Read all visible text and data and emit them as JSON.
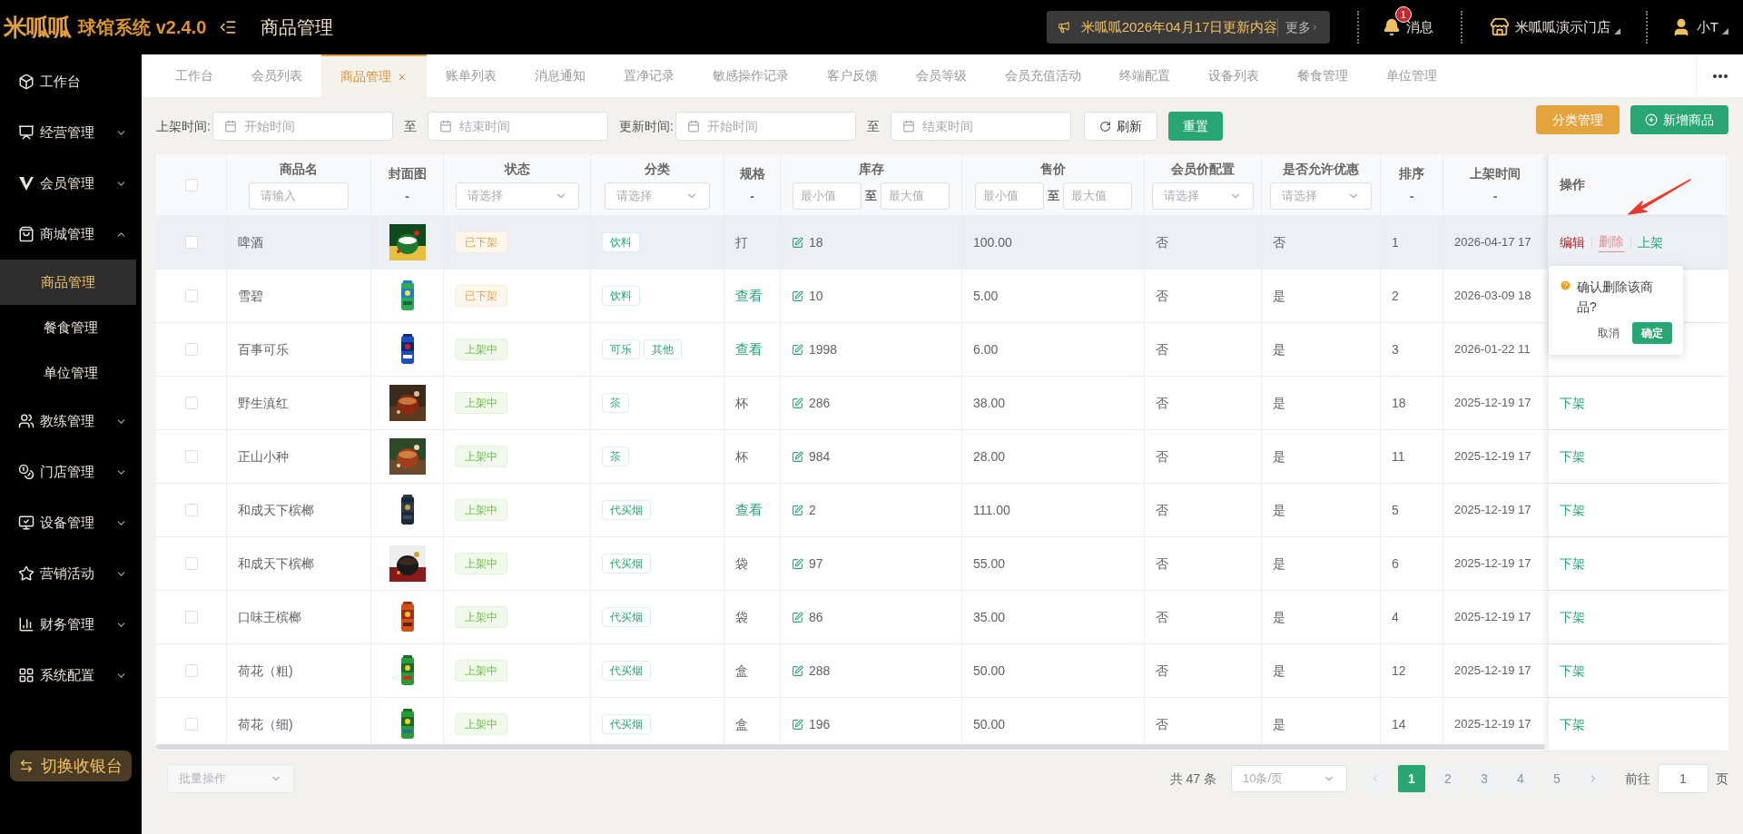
{
  "header": {
    "logo": "米呱呱",
    "app_title": "球馆系统 v2.4.0",
    "page_title": "商品管理",
    "notice": {
      "text": "米呱呱2026年04月17日更新内容",
      "more": "更多"
    },
    "messages": {
      "label": "消息",
      "badge": "1"
    },
    "store": "米呱呱演示门店",
    "user": "小T"
  },
  "sidebar": {
    "items": [
      {
        "label": "工作台"
      },
      {
        "label": "经营管理",
        "expanded": false
      },
      {
        "label": "会员管理",
        "expanded": false
      },
      {
        "label": "商城管理",
        "expanded": true,
        "children": [
          {
            "label": "商品管理",
            "selected": true
          },
          {
            "label": "餐食管理",
            "selected": false
          },
          {
            "label": "单位管理",
            "selected": false
          }
        ]
      },
      {
        "label": "教练管理",
        "expanded": false
      },
      {
        "label": "门店管理",
        "expanded": false
      },
      {
        "label": "设备管理",
        "expanded": false
      },
      {
        "label": "营销活动",
        "expanded": false
      },
      {
        "label": "财务管理",
        "expanded": false
      },
      {
        "label": "系统配置",
        "expanded": false
      }
    ],
    "cashier_button": "切换收银台"
  },
  "tabs": [
    {
      "label": "工作台",
      "selected": false
    },
    {
      "label": "会员列表",
      "selected": false
    },
    {
      "label": "商品管理",
      "selected": true
    },
    {
      "label": "账单列表",
      "selected": false
    },
    {
      "label": "消息通知",
      "selected": false
    },
    {
      "label": "置净记录",
      "selected": false
    },
    {
      "label": "敏感操作记录",
      "selected": false
    },
    {
      "label": "客户反馈",
      "selected": false
    },
    {
      "label": "会员等级",
      "selected": false
    },
    {
      "label": "会员充值活动",
      "selected": false
    },
    {
      "label": "终端配置",
      "selected": false
    },
    {
      "label": "设备列表",
      "selected": false
    },
    {
      "label": "餐食管理",
      "selected": false
    },
    {
      "label": "单位管理",
      "selected": false
    }
  ],
  "filters": {
    "listed_label": "上架时间:",
    "updated_label": "更新时间:",
    "start_placeholder": "开始时间",
    "end_placeholder": "结束时间",
    "start_placeholder_2": "开始时间",
    "end_placeholder_2": "结束时间",
    "to": "至",
    "to_2": "至",
    "refresh": "刷新",
    "reset": "重置",
    "category_manage": "分类管理",
    "add_product": "新增商品"
  },
  "table": {
    "select_all_checked": false,
    "columns": [
      {
        "label": "商品名",
        "kind": "input",
        "placeholder": "请输入"
      },
      {
        "label": "封面图",
        "kind": "dash",
        "dash": "-"
      },
      {
        "label": "状态",
        "kind": "select",
        "placeholder": "请选择"
      },
      {
        "label": "分类",
        "kind": "select",
        "placeholder": "请选择"
      },
      {
        "label": "规格",
        "kind": "dash",
        "dash": "-"
      },
      {
        "label": "库存",
        "kind": "range",
        "min": "最小值",
        "to": "至",
        "max": "最大值"
      },
      {
        "label": "售价",
        "kind": "range",
        "min": "最小值",
        "to": "至",
        "max": "最大值"
      },
      {
        "label": "会员价配置",
        "kind": "select",
        "placeholder": "请选择"
      },
      {
        "label": "是否允许优惠",
        "kind": "select",
        "placeholder": "请选择"
      },
      {
        "label": "排序",
        "kind": "dash",
        "dash": "-"
      },
      {
        "label": "上架时间",
        "kind": "dash",
        "dash": "-"
      },
      {
        "label": "操作",
        "kind": "actions"
      }
    ],
    "rows": [
      {
        "checked": false,
        "highlighted": true,
        "name": "啤酒",
        "cover": {
          "kind": "picture"
        },
        "status": {
          "kind": "off",
          "text": "已下架"
        },
        "categories": [
          "饮料"
        ],
        "spec": {
          "kind": "text",
          "text": "打"
        },
        "stock": "18",
        "price": "100.00",
        "member_price": "否",
        "discount": "否",
        "sort": "1",
        "listed_at": "2026-04-17 17",
        "actions": [
          {
            "kind": "edit",
            "text": "编辑"
          },
          {
            "kind": "delete",
            "text": "删除"
          },
          {
            "kind": "publish",
            "text": "上架"
          }
        ]
      },
      {
        "checked": false,
        "highlighted": false,
        "name": "雪碧",
        "cover": {
          "kind": "picture"
        },
        "status": {
          "kind": "off",
          "text": "已下架"
        },
        "categories": [
          "饮料"
        ],
        "spec": {
          "kind": "link",
          "text": "查看"
        },
        "stock": "10",
        "price": "5.00",
        "member_price": "否",
        "discount": "是",
        "sort": "2",
        "listed_at": "2026-03-09 18"
      },
      {
        "checked": false,
        "highlighted": false,
        "name": "百事可乐",
        "cover": {
          "kind": "picture"
        },
        "status": {
          "kind": "on",
          "text": "上架中"
        },
        "categories": [
          "可乐",
          "其他"
        ],
        "spec": {
          "kind": "link",
          "text": "查看"
        },
        "stock": "1998",
        "price": "6.00",
        "member_price": "否",
        "discount": "是",
        "sort": "3",
        "listed_at": "2026-01-22 11"
      },
      {
        "checked": false,
        "highlighted": false,
        "name": "野生滇红",
        "cover": {
          "kind": "picture"
        },
        "status": {
          "kind": "on",
          "text": "上架中"
        },
        "categories": [
          "茶"
        ],
        "spec": {
          "kind": "text",
          "text": "杯"
        },
        "stock": "286",
        "price": "38.00",
        "member_price": "否",
        "discount": "是",
        "sort": "18",
        "listed_at": "2025-12-19 17",
        "actions": [
          {
            "kind": "publish",
            "text": "下架"
          }
        ]
      },
      {
        "checked": false,
        "highlighted": false,
        "name": "正山小种",
        "cover": {
          "kind": "picture"
        },
        "status": {
          "kind": "on",
          "text": "上架中"
        },
        "categories": [
          "茶"
        ],
        "spec": {
          "kind": "text",
          "text": "杯"
        },
        "stock": "984",
        "price": "28.00",
        "member_price": "否",
        "discount": "是",
        "sort": "11",
        "listed_at": "2025-12-19 17",
        "actions": [
          {
            "kind": "publish",
            "text": "下架"
          }
        ]
      },
      {
        "checked": false,
        "highlighted": false,
        "name": "和成天下槟榔",
        "cover": {
          "kind": "picture"
        },
        "status": {
          "kind": "on",
          "text": "上架中"
        },
        "categories": [
          "代买烟"
        ],
        "spec": {
          "kind": "link",
          "text": "查看"
        },
        "stock": "2",
        "price": "111.00",
        "member_price": "否",
        "discount": "是",
        "sort": "5",
        "listed_at": "2025-12-19 17",
        "actions": [
          {
            "kind": "publish",
            "text": "下架"
          }
        ]
      },
      {
        "checked": false,
        "highlighted": false,
        "name": "和成天下槟榔",
        "cover": {
          "kind": "picture"
        },
        "status": {
          "kind": "on",
          "text": "上架中"
        },
        "categories": [
          "代买烟"
        ],
        "spec": {
          "kind": "text",
          "text": "袋"
        },
        "stock": "97",
        "price": "55.00",
        "member_price": "否",
        "discount": "是",
        "sort": "6",
        "listed_at": "2025-12-19 17",
        "actions": [
          {
            "kind": "publish",
            "text": "下架"
          }
        ]
      },
      {
        "checked": false,
        "highlighted": false,
        "name": "口味王槟榔",
        "cover": {
          "kind": "picture"
        },
        "status": {
          "kind": "on",
          "text": "上架中"
        },
        "categories": [
          "代买烟"
        ],
        "spec": {
          "kind": "text",
          "text": "袋"
        },
        "stock": "86",
        "price": "35.00",
        "member_price": "否",
        "discount": "是",
        "sort": "4",
        "listed_at": "2025-12-19 17",
        "actions": [
          {
            "kind": "publish",
            "text": "下架"
          }
        ]
      },
      {
        "checked": false,
        "highlighted": false,
        "name": "荷花（粗)",
        "cover": {
          "kind": "picture"
        },
        "status": {
          "kind": "on",
          "text": "上架中"
        },
        "categories": [
          "代买烟"
        ],
        "spec": {
          "kind": "text",
          "text": "盒"
        },
        "stock": "288",
        "price": "50.00",
        "member_price": "否",
        "discount": "是",
        "sort": "12",
        "listed_at": "2025-12-19 17",
        "actions": [
          {
            "kind": "publish",
            "text": "下架"
          }
        ]
      },
      {
        "checked": false,
        "highlighted": false,
        "name": "荷花（细)",
        "cover": {
          "kind": "picture"
        },
        "status": {
          "kind": "on",
          "text": "上架中"
        },
        "categories": [
          "代买烟"
        ],
        "spec": {
          "kind": "text",
          "text": "盒"
        },
        "stock": "196",
        "price": "50.00",
        "member_price": "否",
        "discount": "是",
        "sort": "14",
        "listed_at": "2025-12-19 17",
        "actions": [
          {
            "kind": "publish",
            "text": "下架"
          }
        ]
      }
    ]
  },
  "popconfirm": {
    "message": "确认删除该商品?",
    "cancel": "取消",
    "confirm": "确定"
  },
  "footer": {
    "batch_placeholder": "批量操作",
    "total": "共 47 条",
    "page_size": "10条/页",
    "pages": [
      {
        "label": "1",
        "selected": true
      },
      {
        "label": "2",
        "selected": false
      },
      {
        "label": "3",
        "selected": false
      },
      {
        "label": "4",
        "selected": false
      },
      {
        "label": "5",
        "selected": false
      }
    ],
    "goto": "前往",
    "goto_value": "1",
    "page_unit": "页"
  }
}
